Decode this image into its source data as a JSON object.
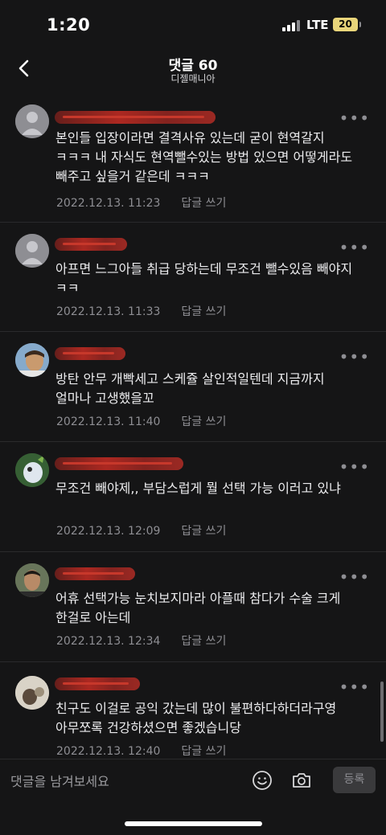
{
  "status": {
    "time": "1:20",
    "network": "LTE",
    "battery": "20"
  },
  "header": {
    "title": "댓글 60",
    "subtitle": "디젤매니아"
  },
  "comments": [
    {
      "text": "본인들 입장이라면 결격사유 있는데 굳이 현역갈지 ㅋㅋㅋ 내 자식도 현역뺄수있는 방법 있으면 어떻게라도 빼주고 싶을거 같은데 ㅋㅋㅋ",
      "date": "2022.12.13. 11:23",
      "reply": "답글 쓰기"
    },
    {
      "text": "아프면 느그아들 취급 당하는데 무조건 뺄수있음 빼야지 ㅋㅋ",
      "date": "2022.12.13. 11:33",
      "reply": "답글 쓰기"
    },
    {
      "text": "방탄 안무 개빡세고 스케쥴 살인적일텐데 지금까지 얼마나 고생했을꼬",
      "date": "2022.12.13. 11:40",
      "reply": "답글 쓰기"
    },
    {
      "text": "무조건 빼야제,, 부담스럽게 뭘 선택 가능 이러고 있냐",
      "date": "2022.12.13. 12:09",
      "reply": "답글 쓰기"
    },
    {
      "text": "어휴 선택가능 눈치보지마라 아플때 참다가 수술 크게 한걸로 아는데",
      "date": "2022.12.13. 12:34",
      "reply": "답글 쓰기"
    },
    {
      "text": "친구도 이걸로 공익 갔는데 많이 불편하다하더라구영 아무쪼록 건강하셨으면 좋겠습니당",
      "date": "2022.12.13. 12:40",
      "reply": "답글 쓰기"
    }
  ],
  "input": {
    "placeholder": "댓글을 남겨보세요",
    "submit": "등록"
  },
  "icons": {
    "back": "chevron-left-icon",
    "more": "more-dots-icon",
    "emoji": "emoji-icon",
    "camera": "camera-icon"
  },
  "colors": {
    "background": "#151516",
    "text": "#e8e8ea",
    "muted": "#8e8e93",
    "redaction": "#b52a22"
  }
}
